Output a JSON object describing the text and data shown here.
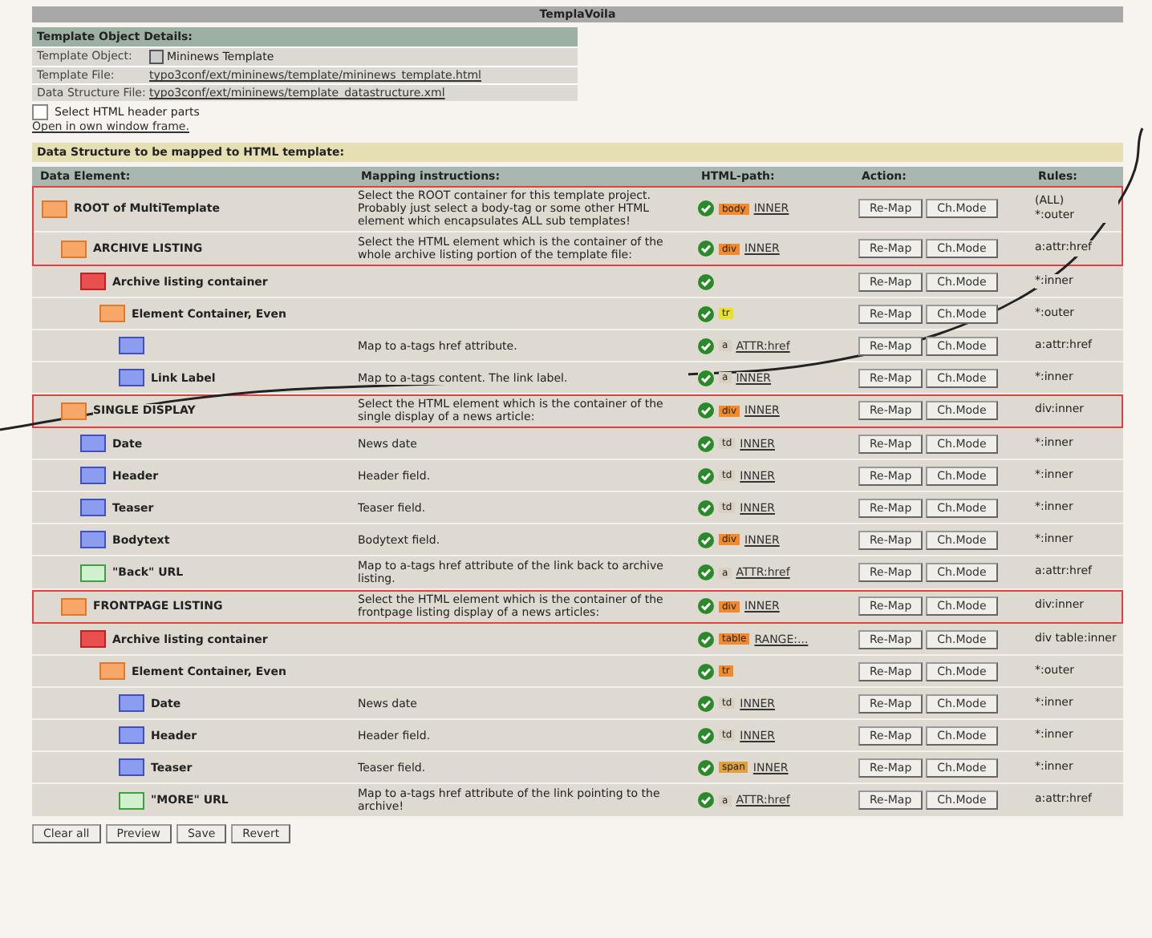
{
  "title": "TemplaVoila",
  "details": {
    "heading": "Template Object Details:",
    "fields": [
      {
        "label": "Template Object:",
        "value": "Mininews Template",
        "kind": "text"
      },
      {
        "label": "Template File:",
        "value": "typo3conf/ext/mininews/template/mininews_template.html",
        "kind": "link"
      },
      {
        "label": "Data Structure File:",
        "value": "typo3conf/ext/mininews/template_datastructure.xml",
        "kind": "link"
      }
    ]
  },
  "header_parts": {
    "label": "Select HTML header parts",
    "checked": false
  },
  "own_window_link": "Open in own window frame.",
  "mapping": {
    "heading": "Data Structure to be mapped to HTML template:",
    "columns": [
      "Data Element:",
      "Mapping instructions:",
      "HTML-path:",
      "Action:",
      "Rules:"
    ],
    "elements": [
      {
        "kind": "section",
        "name": "ROOT of MultiTemplate",
        "instructions": "Select the ROOT container for this template project. Probably just select a body-tag or some other HTML element which encapsulates ALL sub templates!",
        "tag": "body",
        "color": "#f08a2c",
        "path": "INNER",
        "actions": [
          "Re-Map",
          "Ch.Mode"
        ],
        "rules": "(ALL)",
        "rules_extra": "*:outer",
        "highlighted": true,
        "children": [
          {
            "kind": "section",
            "name": "ARCHIVE LISTING",
            "instructions": "Select the HTML element which is the container of the whole archive listing portion of the template file:",
            "tag": "div",
            "color": "#f08a2c",
            "path": "INNER",
            "actions": [
              "Re-Map",
              "Ch.Mode"
            ],
            "rules": "a:attr:href",
            "highlighted": true,
            "children": [
              {
                "kind": "array",
                "name": "Archive listing container",
                "actions": [
                  "Re-Map",
                  "Ch.Mode"
                ],
                "rules": "*:inner",
                "highlighted": false,
                "children": [
                  {
                    "kind": "container",
                    "name": "Element Container, Even",
                    "tag": "tr",
                    "color": "#e8e030",
                    "actions": [
                      "Re-Map",
                      "Ch.Mode"
                    ],
                    "rules": "*:outer",
                    "highlighted": false,
                    "children": [
                      {
                        "kind": "field",
                        "instructions": "Map to a-tags href attribute.",
                        "tag": "a",
                        "color": "#d8d0c0",
                        "path": "ATTR:href",
                        "actions": [
                          "Re-Map",
                          "Ch.Mode"
                        ],
                        "rules": "a:attr:href",
                        "highlighted": false
                      },
                      {
                        "kind": "field",
                        "name": "Link Label",
                        "instructions": "Map to a-tags content. The link label.",
                        "tag": "a",
                        "color": "#d8d0c0",
                        "path": "INNER",
                        "actions": [
                          "Re-Map",
                          "Ch.Mode"
                        ],
                        "rules": "*:inner",
                        "highlighted": false
                      }
                    ]
                  }
                ]
              }
            ]
          },
          {
            "kind": "section",
            "name": "SINGLE DISPLAY",
            "instructions": "Select the HTML element which is the container of the single display of a news article:",
            "tag": "div",
            "color": "#f08a2c",
            "path": "INNER",
            "actions": [
              "Re-Map",
              "Ch.Mode"
            ],
            "rules": "div:inner",
            "highlighted": true,
            "children": [
              {
                "kind": "field",
                "name": "Date",
                "instructions": "News date",
                "tag": "td",
                "color": "#d8d0c0",
                "path": "INNER",
                "actions": [
                  "Re-Map",
                  "Ch.Mode"
                ],
                "rules": "*:inner",
                "highlighted": false
              },
              {
                "kind": "field",
                "name": "Header",
                "instructions": "Header field.",
                "tag": "td",
                "color": "#d8d0c0",
                "path": "INNER",
                "actions": [
                  "Re-Map",
                  "Ch.Mode"
                ],
                "rules": "*:inner",
                "highlighted": false
              },
              {
                "kind": "field",
                "name": "Teaser",
                "instructions": "Teaser field.",
                "tag": "td",
                "color": "#d8d0c0",
                "path": "INNER",
                "actions": [
                  "Re-Map",
                  "Ch.Mode"
                ],
                "rules": "*:inner",
                "highlighted": false
              },
              {
                "kind": "field",
                "name": "Bodytext",
                "instructions": "Bodytext field.",
                "tag": "div",
                "color": "#f08a2c",
                "path": "INNER",
                "actions": [
                  "Re-Map",
                  "Ch.Mode"
                ],
                "rules": "*:inner",
                "highlighted": false
              },
              {
                "kind": "link",
                "name": "\"Back\" URL",
                "instructions": "Map to a-tags href attribute of the link back to archive listing.",
                "tag": "a",
                "color": "#d8d0c0",
                "path": "ATTR:href",
                "actions": [
                  "Re-Map",
                  "Ch.Mode"
                ],
                "rules": "a:attr:href",
                "highlighted": false
              }
            ]
          },
          {
            "kind": "section",
            "name": "FRONTPAGE LISTING",
            "instructions": "Select the HTML element which is the container of the frontpage listing display of a news articles:",
            "tag": "div",
            "color": "#f08a2c",
            "path": "INNER",
            "actions": [
              "Re-Map",
              "Ch.Mode"
            ],
            "rules": "div:inner",
            "highlighted": true,
            "children": [
              {
                "kind": "array",
                "name": "Archive listing container",
                "tag": "table",
                "color": "#f08a2c",
                "path": "RANGE:...",
                "actions": [
                  "Re-Map",
                  "Ch.Mode"
                ],
                "rules": "div table:inner",
                "highlighted": false,
                "children": [
                  {
                    "kind": "container",
                    "name": "Element Container, Even",
                    "tag": "tr",
                    "color": "#f08a2c",
                    "actions": [
                      "Re-Map",
                      "Ch.Mode"
                    ],
                    "rules": "*:outer",
                    "highlighted": false,
                    "children": [
                      {
                        "kind": "field",
                        "name": "Date",
                        "instructions": "News date",
                        "tag": "td",
                        "color": "#d8d0c0",
                        "path": "INNER",
                        "actions": [
                          "Re-Map",
                          "Ch.Mode"
                        ],
                        "rules": "*:inner",
                        "highlighted": false
                      },
                      {
                        "kind": "field",
                        "name": "Header",
                        "instructions": "Header field.",
                        "tag": "td",
                        "color": "#d8d0c0",
                        "path": "INNER",
                        "actions": [
                          "Re-Map",
                          "Ch.Mode"
                        ],
                        "rules": "*:inner",
                        "highlighted": false
                      },
                      {
                        "kind": "field",
                        "name": "Teaser",
                        "instructions": "Teaser field.",
                        "tag": "span",
                        "color": "#e0a040",
                        "path": "INNER",
                        "actions": [
                          "Re-Map",
                          "Ch.Mode"
                        ],
                        "rules": "*:inner",
                        "highlighted": false
                      },
                      {
                        "kind": "link",
                        "name": "\"MORE\" URL",
                        "instructions": "Map to a-tags href attribute of the link pointing to the archive!",
                        "tag": "a",
                        "color": "#d8d0c0",
                        "path": "ATTR:href",
                        "actions": [
                          "Re-Map",
                          "Ch.Mode"
                        ],
                        "rules": "a:attr:href",
                        "highlighted": false
                      }
                    ]
                  }
                ]
              }
            ]
          }
        ]
      }
    ]
  },
  "buttons": [
    "Clear all",
    "Preview",
    "Save",
    "Revert"
  ]
}
